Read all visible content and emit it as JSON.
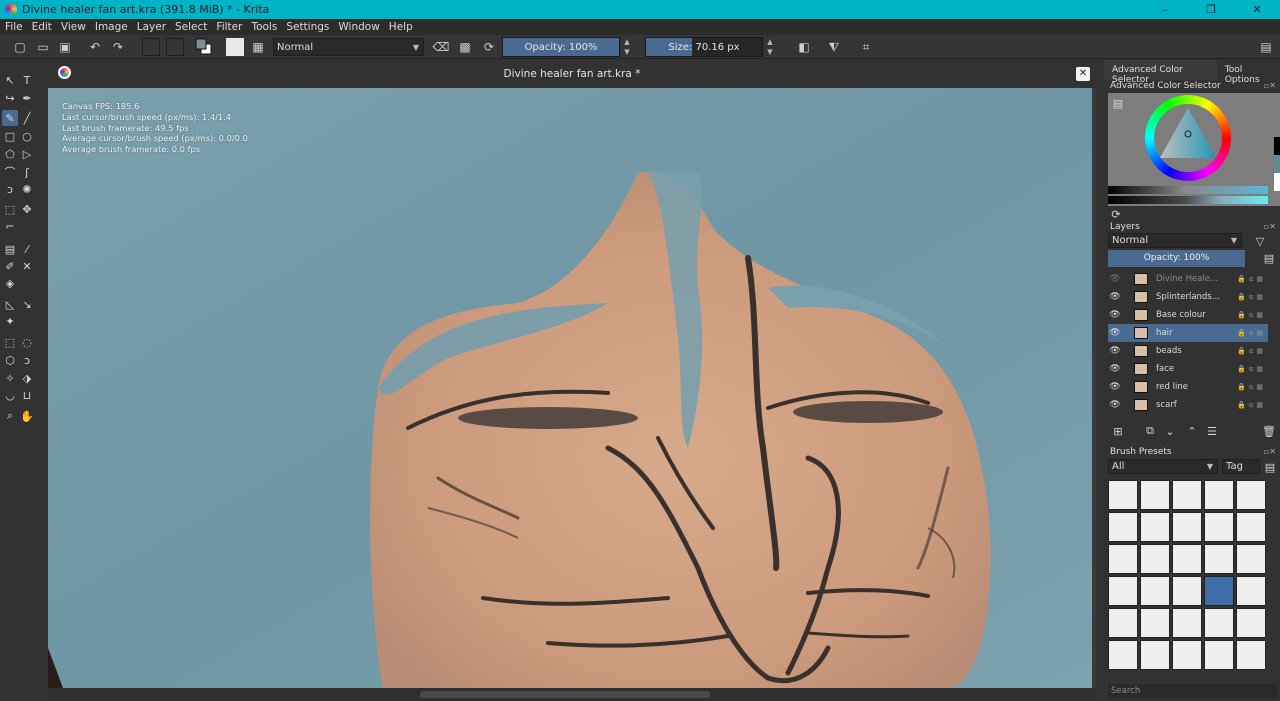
{
  "window": {
    "title": "Divine healer fan art.kra (391.8 MiB)  * - Krita",
    "controls": [
      "–",
      "❐",
      "✕"
    ]
  },
  "menu": [
    "File",
    "Edit",
    "View",
    "Image",
    "Layer",
    "Select",
    "Filter",
    "Tools",
    "Settings",
    "Window",
    "Help"
  ],
  "toolbar": {
    "blend_mode": "Normal",
    "opacity_label": "Opacity: 100%",
    "opacity_fraction": 1.0,
    "size_label": "Size: 70.16 px",
    "size_fill_fraction": 0.4
  },
  "document": {
    "tab_title": "Divine healer fan art.kra *",
    "close_label": "✕"
  },
  "canvas_hud": {
    "fps": "Canvas FPS: 185.6",
    "cursor_speed": "Last cursor/brush speed (px/ms): 1.4/1.4",
    "brush_framerate": "Last brush framerate: 49.5 fps",
    "avg_speed": "Average cursor/brush speed (px/ms): 0.0/0.0",
    "avg_framerate": "Average brush framerate: 0.0 fps"
  },
  "dock": {
    "tab_active": "Advanced Color Selector",
    "tab_other": "Tool Options",
    "color_panel_title": "Advanced Color Selector",
    "layers_title": "Layers",
    "layers_blend": "Normal",
    "layers_opacity": "Opacity:  100%",
    "layers": [
      {
        "name": "Divine Heale...",
        "selected": false,
        "dim": true
      },
      {
        "name": "Splinterlands...",
        "selected": false,
        "dim": false
      },
      {
        "name": "Base colour",
        "selected": false,
        "dim": false
      },
      {
        "name": "hair",
        "selected": true,
        "dim": false
      },
      {
        "name": "beads",
        "selected": false,
        "dim": false
      },
      {
        "name": "face",
        "selected": false,
        "dim": false
      },
      {
        "name": "red line",
        "selected": false,
        "dim": false
      },
      {
        "name": "scarf",
        "selected": false,
        "dim": false
      }
    ],
    "brush_presets_title": "Brush Presets",
    "brush_filter": "All",
    "brush_tag": "Tag",
    "search_placeholder": "Search"
  },
  "colors": {
    "accent": "#4b6a92",
    "titlebar": "#00b4c8",
    "hair": "#7a9eab",
    "skin": "#cf9d80",
    "fg_color": "#7f8f92",
    "bg_color": "#7d7d7d"
  }
}
